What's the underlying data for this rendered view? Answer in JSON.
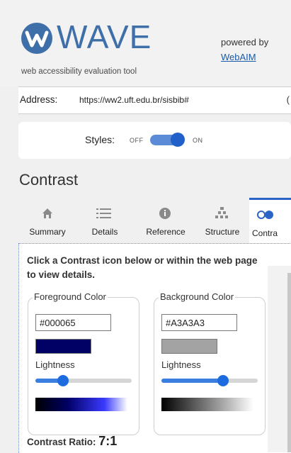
{
  "header": {
    "logo_text": "WAVE",
    "tagline": "web accessibility evaluation tool",
    "powered_by": "powered by",
    "webaim_link": "WebAIM",
    "brand_color": "#3f6fa8"
  },
  "address": {
    "label": "Address:",
    "value": "https://ww2.uft.edu.br/sisbib#",
    "cut_glyph": "("
  },
  "styles": {
    "label": "Styles:",
    "off_label": "OFF",
    "on_label": "ON",
    "state": "on"
  },
  "section_title": "Contrast",
  "tabs": [
    {
      "label": "Summary",
      "icon": "home-icon",
      "active": false
    },
    {
      "label": "Details",
      "icon": "list-icon",
      "active": false
    },
    {
      "label": "Reference",
      "icon": "info-icon",
      "active": false
    },
    {
      "label": "Structure",
      "icon": "hierarchy-icon",
      "active": false
    },
    {
      "label": "Contrast",
      "icon": "contrast-icon",
      "active": true
    }
  ],
  "tab5_visible_label": "Contra",
  "panel": {
    "intro": "Click a Contrast icon below or within the web page to view details.",
    "foreground": {
      "legend": "Foreground Color",
      "value": "#000065",
      "swatch_color": "#000065",
      "lightness_label": "Lightness",
      "lightness_level": 0.29
    },
    "background": {
      "legend": "Background Color",
      "value": "#A3A3A3",
      "swatch_color": "#A3A3A3",
      "lightness_label": "Lightness",
      "lightness_level": 0.64
    },
    "ratio_label": "Contrast Ratio:",
    "ratio_value": "7:1"
  }
}
